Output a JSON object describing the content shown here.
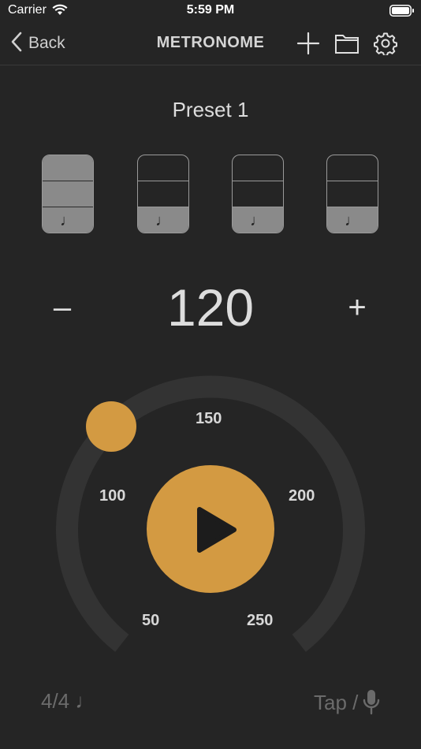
{
  "status_bar": {
    "carrier": "Carrier",
    "time": "5:59 PM"
  },
  "nav": {
    "back_label": "Back",
    "title": "METRONOME",
    "icons": [
      "add-icon",
      "folder-icon",
      "gear-icon"
    ]
  },
  "preset": {
    "name": "Preset 1"
  },
  "beats": [
    {
      "accent": true,
      "note": "♩"
    },
    {
      "accent": false,
      "note": "♩"
    },
    {
      "accent": false,
      "note": "♩"
    },
    {
      "accent": false,
      "note": "♩"
    }
  ],
  "tempo": {
    "minus_label": "–",
    "value": "120",
    "plus_label": "+"
  },
  "dial": {
    "labels": [
      "50",
      "100",
      "150",
      "200",
      "250"
    ]
  },
  "bottom": {
    "time_signature": "4/4 ♩",
    "tap_label": "Tap /"
  },
  "colors": {
    "background": "#252525",
    "accent": "#d39a42",
    "track": "#333333",
    "muted_text": "#6b6b6b"
  }
}
